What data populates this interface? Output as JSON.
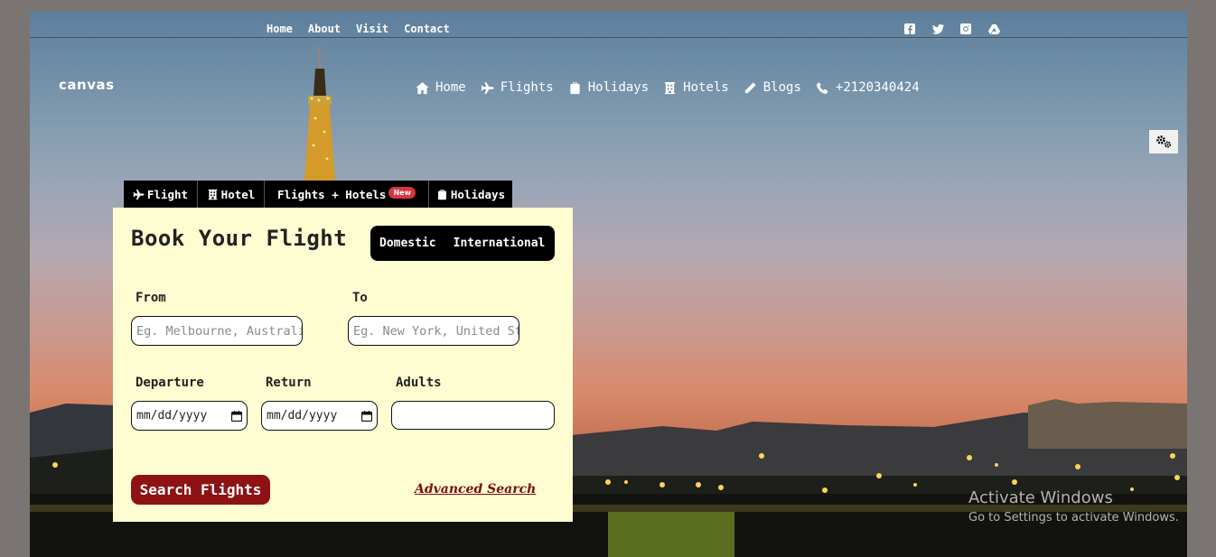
{
  "top_links": [
    "Home",
    "About",
    "Visit",
    "Contact"
  ],
  "social_icons": [
    "facebook-icon",
    "twitter-icon",
    "instagram-icon",
    "google-drive-icon"
  ],
  "logo": "canvas",
  "main_nav": {
    "home": "Home",
    "flights": "Flights",
    "holidays": "Holidays",
    "hotels": "Hotels",
    "blogs": "Blogs",
    "phone": "+2120340424"
  },
  "tabs": {
    "flight": "Flight",
    "hotel": "Hotel",
    "flights_hotels": "Flights + Hotels",
    "new_badge": "New",
    "holidays": "Holidays"
  },
  "card": {
    "title": "Book Your Flight",
    "domestic": "Domestic",
    "international": "International",
    "from_label": "From",
    "to_label": "To",
    "from_placeholder": "Eg. Melbourne, Australia",
    "to_placeholder": "Eg. New York, United States",
    "departure_label": "Departure",
    "return_label": "Return",
    "adults_label": "Adults",
    "departure_value": "mm/dd/yyyy",
    "return_value": "mm/dd/yyyy",
    "adults_value": "",
    "search_button": "Search Flights",
    "advanced_search": "Advanced Search"
  },
  "watermark": {
    "line1": "Activate Windows",
    "line2": "Go to Settings to activate Windows."
  },
  "colors": {
    "card_bg": "#fdfdd1",
    "search_button": "#8e1214",
    "badge": "#d9363e"
  }
}
